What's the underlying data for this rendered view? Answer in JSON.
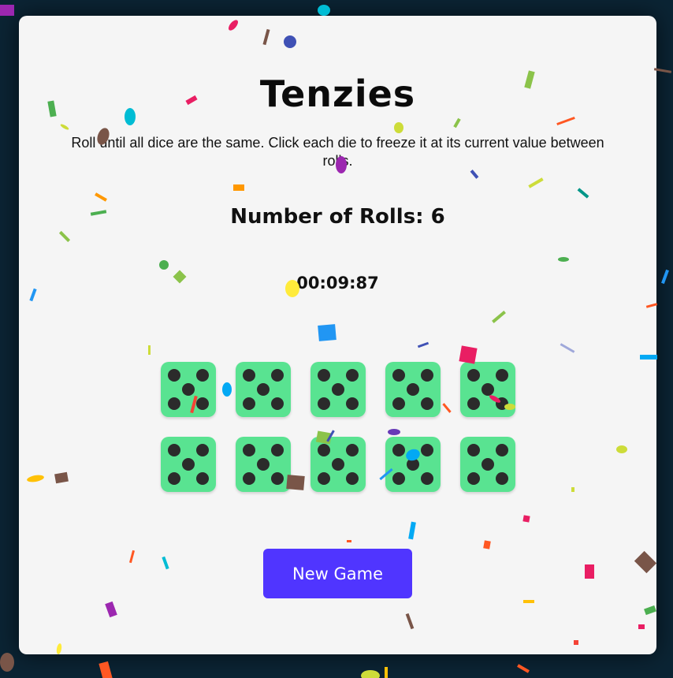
{
  "app": {
    "title": "Tenzies",
    "instructions": "Roll until all dice are the same. Click each die to freeze it at its current value between rolls."
  },
  "stats": {
    "rolls_text": "Number of Rolls: 6",
    "timer_text": "00:09:87"
  },
  "dice": [
    {
      "value": 5,
      "held": true
    },
    {
      "value": 5,
      "held": true
    },
    {
      "value": 5,
      "held": true
    },
    {
      "value": 5,
      "held": true
    },
    {
      "value": 5,
      "held": true
    },
    {
      "value": 5,
      "held": true
    },
    {
      "value": 5,
      "held": true
    },
    {
      "value": 5,
      "held": true
    },
    {
      "value": 5,
      "held": true
    },
    {
      "value": 5,
      "held": true
    }
  ],
  "actions": {
    "new_game_label": "New Game"
  },
  "colors": {
    "page_background": "#0b2434",
    "card_background": "#f5f5f5",
    "die_held": "#59e391",
    "pip": "#2b2b2b",
    "button": "#5035ff",
    "button_text": "#ffffff"
  },
  "celebration": {
    "confetti_visible": true
  }
}
